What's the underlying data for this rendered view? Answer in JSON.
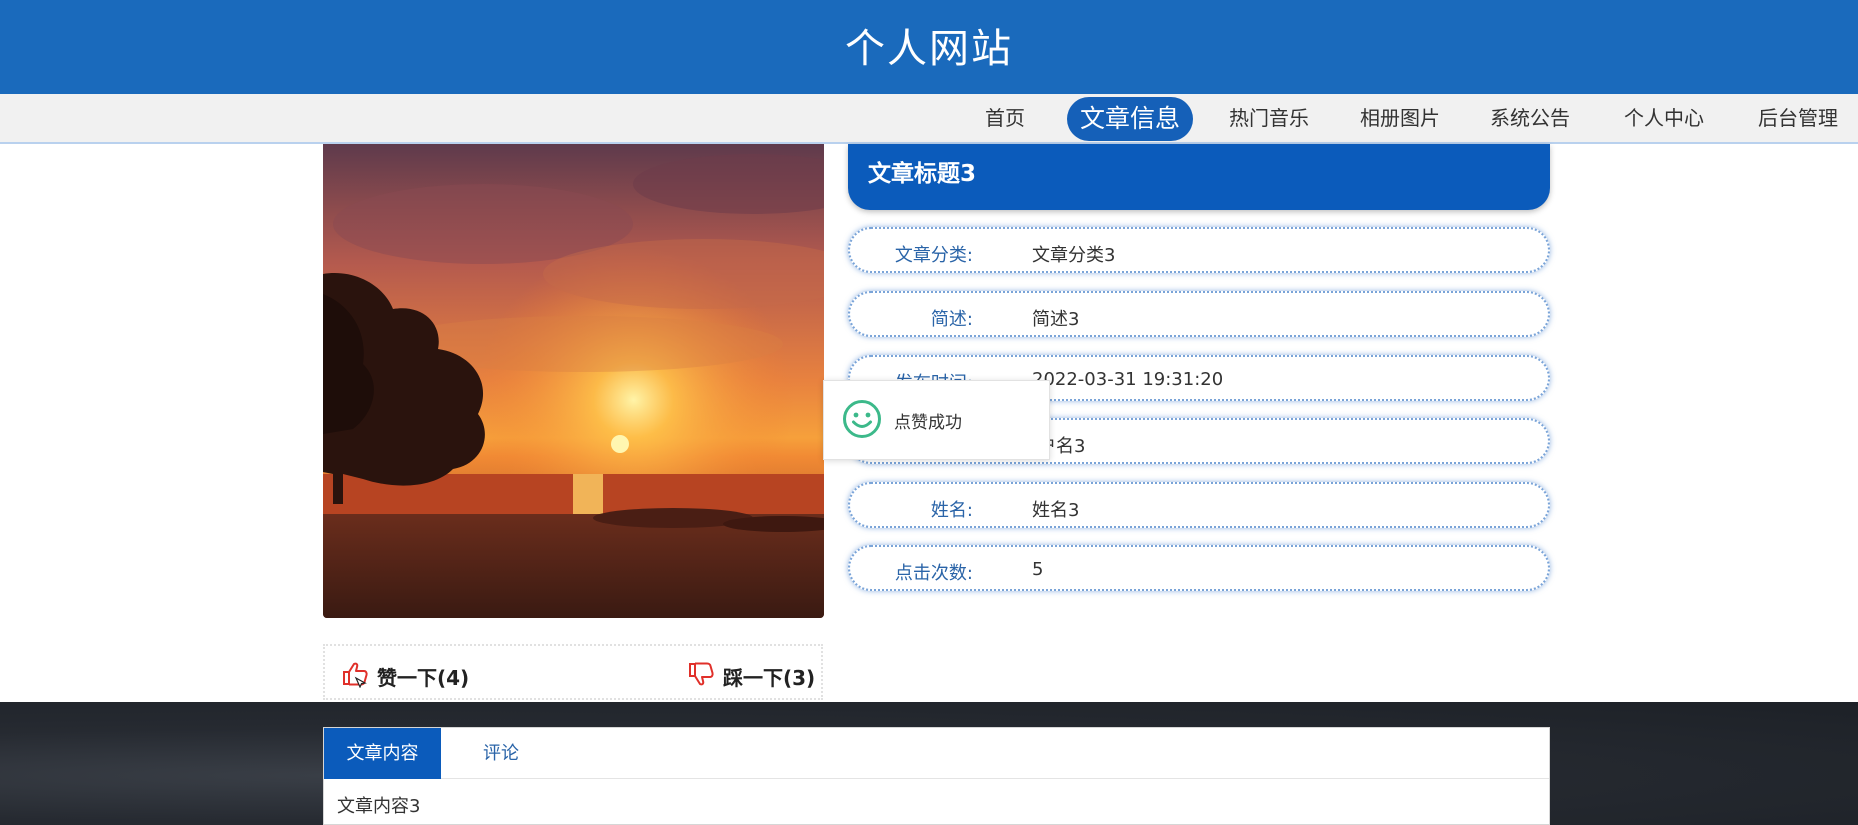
{
  "header": {
    "title": "个人网站"
  },
  "nav": {
    "items": [
      {
        "label": "首页"
      },
      {
        "label": "文章信息",
        "active": true
      },
      {
        "label": "热门音乐"
      },
      {
        "label": "相册图片"
      },
      {
        "label": "系统公告"
      },
      {
        "label": "个人中心"
      },
      {
        "label": "后台管理"
      }
    ]
  },
  "article": {
    "title": "文章标题3",
    "fields": [
      {
        "label": "文章分类:",
        "value": "文章分类3"
      },
      {
        "label": "简述:",
        "value": "简述3"
      },
      {
        "label": "发布时间:",
        "value": "2022-03-31 19:31:20"
      },
      {
        "label": "",
        "value": "户名3"
      },
      {
        "label": "姓名:",
        "value": "姓名3"
      },
      {
        "label": "点击次数:",
        "value": "5"
      }
    ]
  },
  "toast": {
    "text": "点赞成功",
    "icon": "smile-icon"
  },
  "vote": {
    "like_label": "赞一下(4)",
    "dislike_label": "踩一下(3)",
    "like_icon": "thumbs-up-icon",
    "dislike_icon": "thumbs-down-icon"
  },
  "tabs": {
    "items": [
      {
        "label": "文章内容",
        "active": true
      },
      {
        "label": "评论",
        "active": false
      }
    ],
    "content": "文章内容3"
  },
  "colors": {
    "header_bg": "#1a6abc",
    "accent": "#0b5bbb",
    "nav_bg": "#f1f1f1",
    "vote_icon": "#e0302a"
  }
}
